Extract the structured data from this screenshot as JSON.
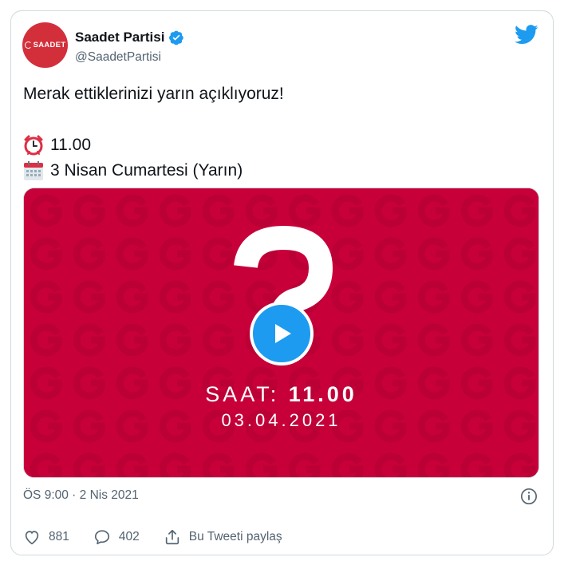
{
  "author": {
    "display_name": "Saadet Partisi",
    "handle": "@SaadetPartisi",
    "avatar_text": "SAADET",
    "verified": true
  },
  "tweet": {
    "line1": "Merak ettiklerinizi yarın açıklıyoruz!",
    "time_line": "11.00",
    "time_emoji": "alarm-clock-icon",
    "date_line": "3 Nisan Cumartesi (Yarın)",
    "date_emoji": "calendar-icon"
  },
  "media": {
    "caption_saat_label": "SAAT: ",
    "caption_saat_time": "11.00",
    "caption_date": "03.04.2021",
    "background_color": "#c8003a",
    "play_icon": "play-icon"
  },
  "timestamp": "ÖS 9:00 · 2 Nis 2021",
  "actions": {
    "like_count": "881",
    "reply_count": "402",
    "share_label": "Bu Tweeti paylaş"
  },
  "colors": {
    "brand_blue": "#1d9bf0",
    "text_secondary": "#536471"
  }
}
